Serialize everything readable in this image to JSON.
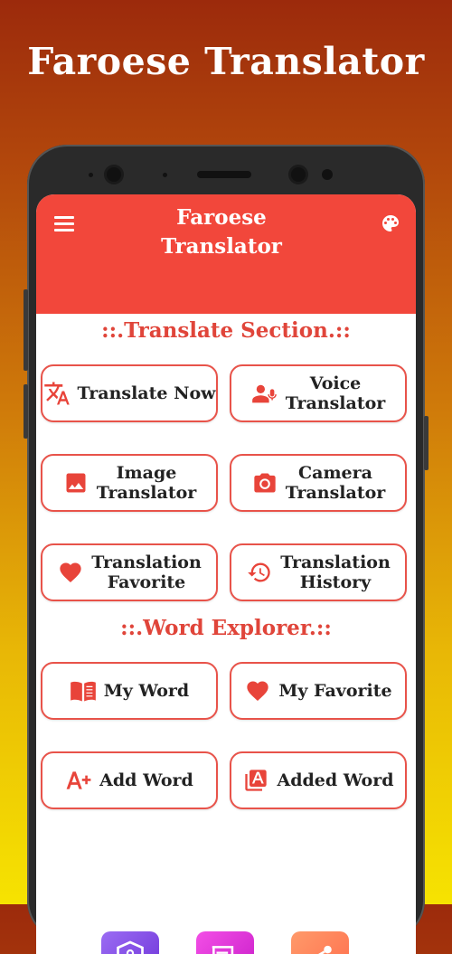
{
  "promo": {
    "title": "Faroese Translator"
  },
  "appbar": {
    "title_line1": "Faroese",
    "title_line2": "Translator"
  },
  "sections": {
    "translate": "::.Translate Section.::",
    "word": "::.Word Explorer.::"
  },
  "buttons": {
    "translate_now": "Translate Now",
    "voice_translator": "Voice\nTranslator",
    "image_translator": "Image\nTranslator",
    "camera_translator": "Camera\nTranslator",
    "translation_favorite": "Translation\nFavorite",
    "translation_history": "Translation\nHistory",
    "my_word": "My Word",
    "my_favorite": "My Favorite",
    "add_word": "Add Word",
    "added_word": "Added Word"
  },
  "icons": {
    "menu": "menu-icon",
    "palette": "palette-icon",
    "translate": "translate-icon",
    "voice": "voice-icon",
    "image": "image-icon",
    "camera": "camera-icon",
    "heart": "heart-icon",
    "history": "history-icon",
    "book": "book-icon",
    "add_text": "add-text-icon",
    "font_box": "font-box-icon",
    "privacy": "privacy-shield-icon",
    "feedback": "feedback-icon",
    "share": "share-icon"
  },
  "colors": {
    "accent": "#f2473b",
    "button_border": "#e8534a",
    "section_text": "#e0453a",
    "privacy_bg": "#7b3fe4",
    "feedback_bg": "#e63bd9",
    "share_bg": "#ff7a59"
  }
}
